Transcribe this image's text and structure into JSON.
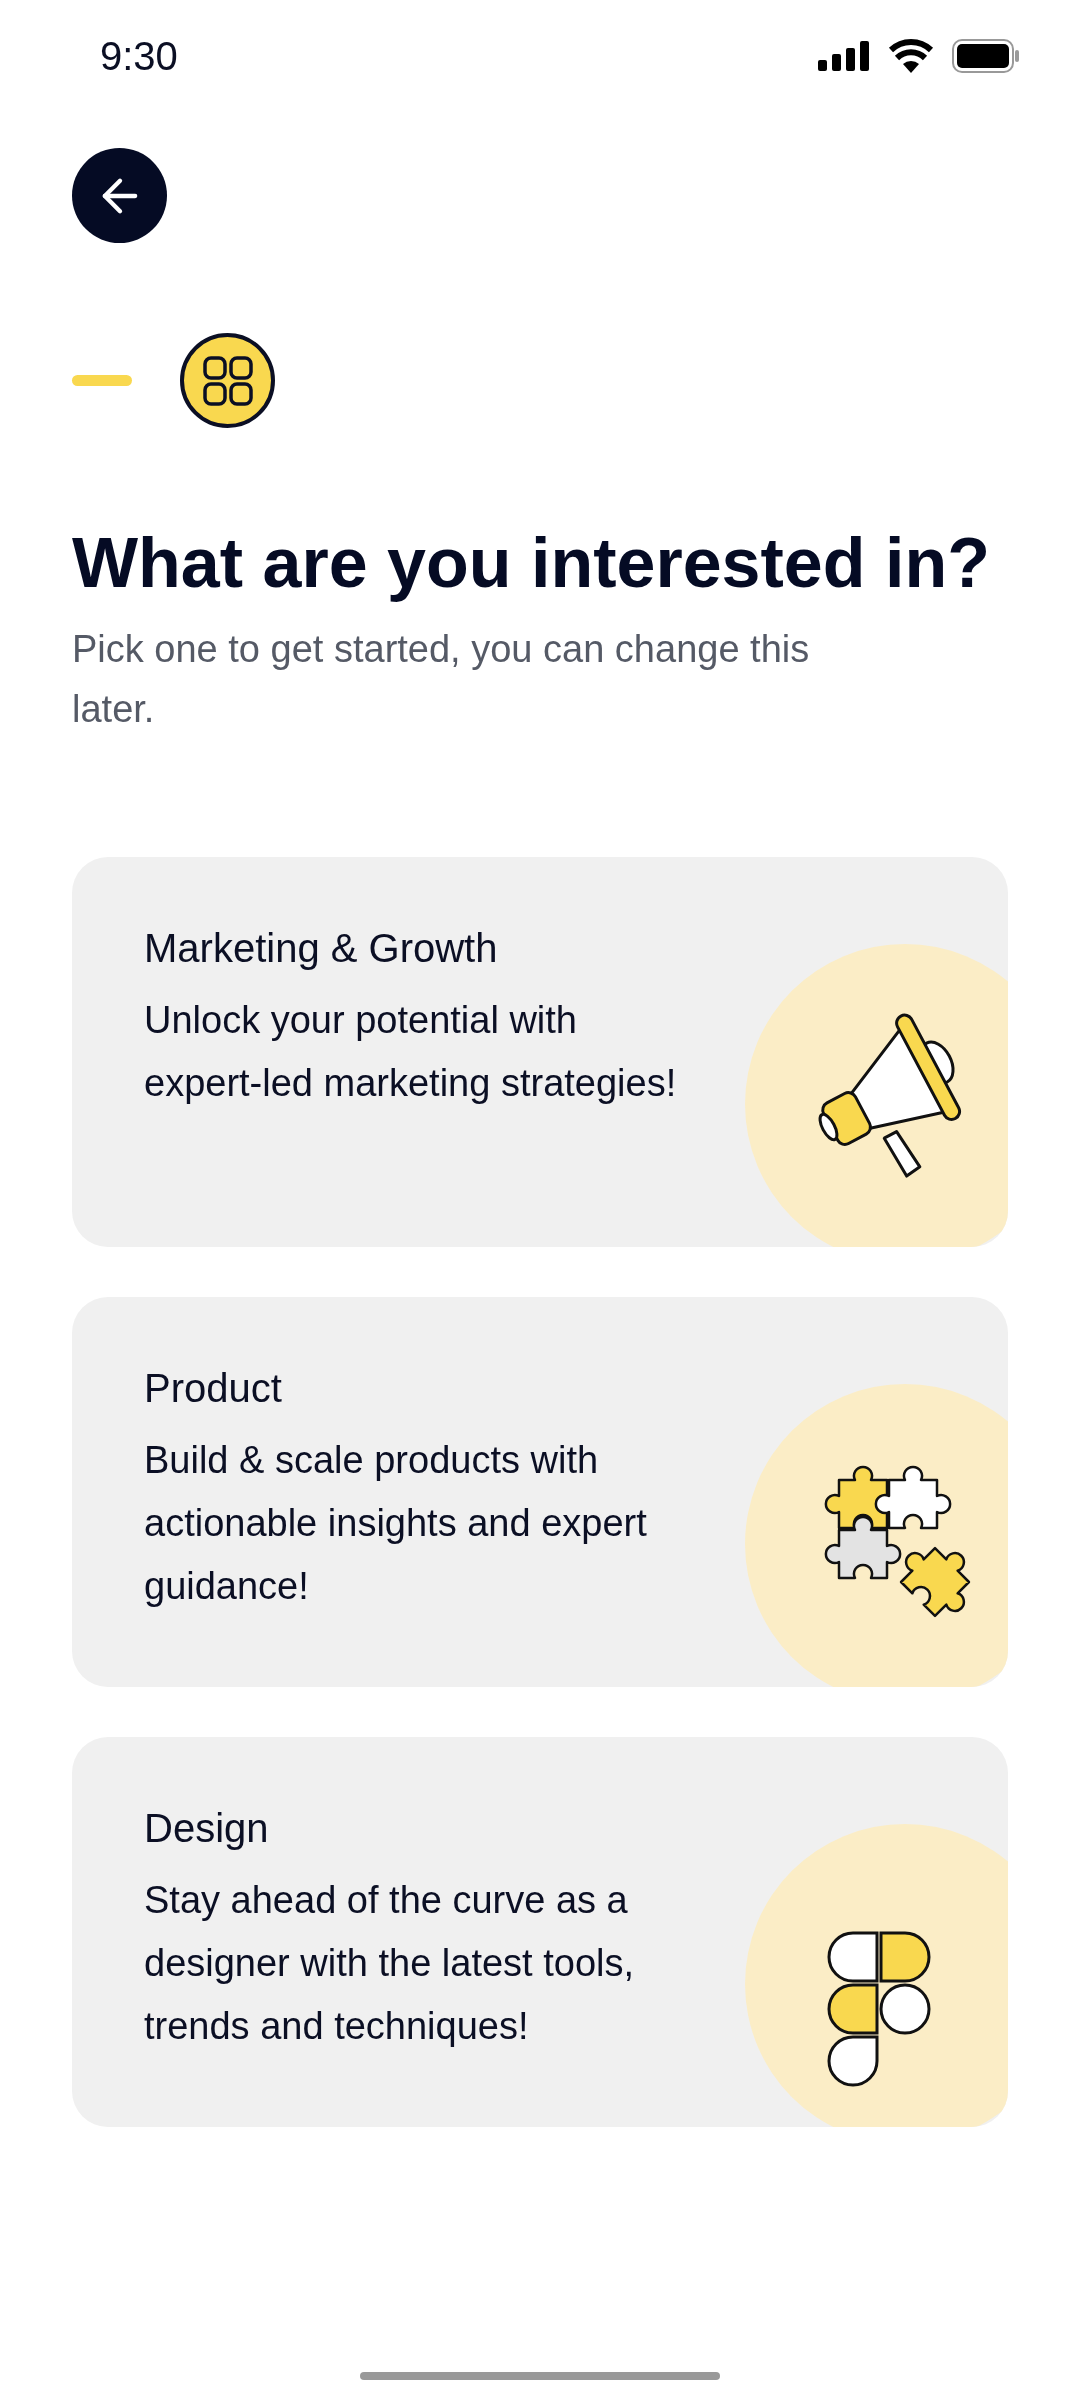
{
  "status_bar": {
    "time": "9:30"
  },
  "progress": {
    "steps": [
      {
        "selected": false
      },
      {
        "selected": true
      }
    ]
  },
  "title": "What are you interested in?",
  "subtitle": "Pick one to get started, you can change this later.",
  "options": [
    {
      "title": "Marketing & Growth",
      "description": "Unlock your potential with expert-led marketing strategies!",
      "kind": "megaphone"
    },
    {
      "title": "Product",
      "description": "Build & scale products with actionable insights and expert guidance!",
      "kind": "puzzle"
    },
    {
      "title": "Design",
      "description": "Stay ahead of the curve as a designer with the latest tools, trends and techniques!",
      "kind": "shapes"
    }
  ]
}
